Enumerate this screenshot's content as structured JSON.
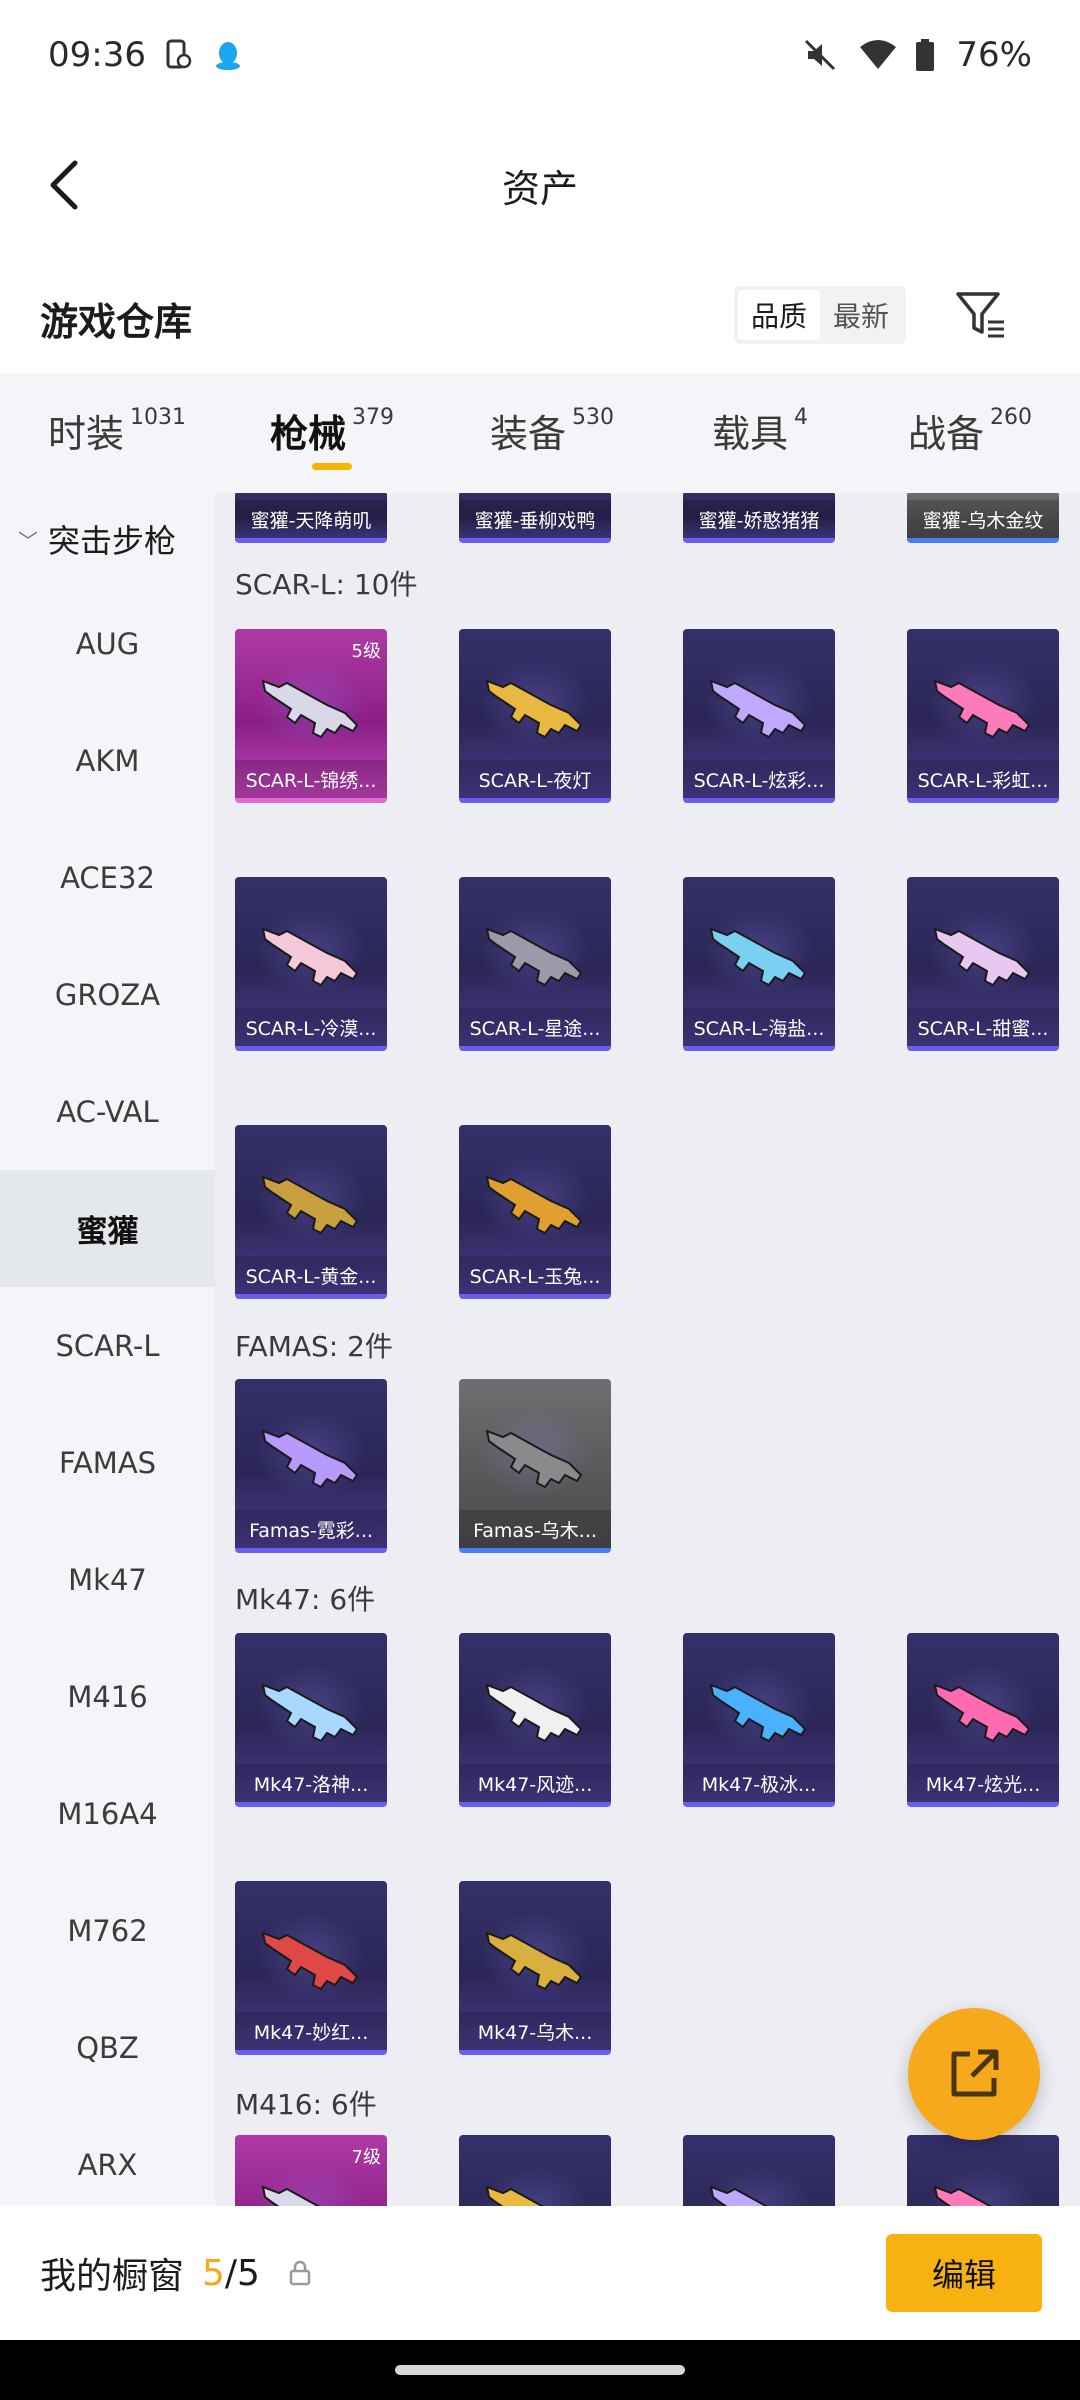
{
  "status_bar": {
    "time": "09:36",
    "battery": "76%",
    "icons": [
      "phone-sync-icon",
      "qq-penguin-icon",
      "mute-icon",
      "wifi-icon",
      "battery-icon"
    ]
  },
  "navbar": {
    "title": "资产",
    "back_icon": "chevron-left-icon"
  },
  "warehouse": {
    "title": "游戏仓库",
    "sort_options": [
      "品质",
      "最新"
    ],
    "sort_selected": "品质",
    "filter_icon": "filter-icon"
  },
  "category_tabs": [
    {
      "label": "时装",
      "count": "1031"
    },
    {
      "label": "枪械",
      "count": "379",
      "active": true
    },
    {
      "label": "装备",
      "count": "530"
    },
    {
      "label": "载具",
      "count": "4"
    },
    {
      "label": "战备",
      "count": "260"
    }
  ],
  "sidebar": {
    "group": "突击步枪",
    "items": [
      "AUG",
      "AKM",
      "ACE32",
      "GROZA",
      "AC-VAL",
      "蜜獾",
      "SCAR-L",
      "FAMAS",
      "Mk47",
      "M416",
      "M16A4",
      "M762",
      "QBZ",
      "ARX"
    ],
    "active": "蜜獾"
  },
  "grid": {
    "top_row": [
      "蜜獾-天降萌叽",
      "蜜獾-垂柳戏鸭",
      "蜜獾-娇憨猪猪",
      "蜜獾-乌木金纹"
    ],
    "sections": [
      {
        "title": "SCAR-L: 10件",
        "items": [
          {
            "name": "SCAR-L-锦绣...",
            "level": "5级"
          },
          {
            "name": "SCAR-L-夜灯"
          },
          {
            "name": "SCAR-L-炫彩..."
          },
          {
            "name": "SCAR-L-彩虹..."
          },
          {
            "name": "SCAR-L-冷漠..."
          },
          {
            "name": "SCAR-L-星途..."
          },
          {
            "name": "SCAR-L-海盐..."
          },
          {
            "name": "SCAR-L-甜蜜..."
          },
          {
            "name": "SCAR-L-黄金..."
          },
          {
            "name": "SCAR-L-玉兔..."
          }
        ]
      },
      {
        "title": "FAMAS: 2件",
        "items": [
          {
            "name": "Famas-霓彩..."
          },
          {
            "name": "Famas-乌木..."
          }
        ]
      },
      {
        "title": "Mk47: 6件",
        "items": [
          {
            "name": "Mk47-洛神..."
          },
          {
            "name": "Mk47-风迹..."
          },
          {
            "name": "Mk47-极冰..."
          },
          {
            "name": "Mk47-炫光..."
          },
          {
            "name": "Mk47-妙红..."
          },
          {
            "name": "Mk47-乌木..."
          }
        ]
      },
      {
        "title": "M416: 6件",
        "items": [
          {
            "name": "",
            "level": "7级"
          },
          {
            "name": ""
          },
          {
            "name": ""
          },
          {
            "name": ""
          }
        ]
      }
    ]
  },
  "fab": {
    "icon": "share-external-icon"
  },
  "showcase": {
    "label": "我的橱窗",
    "current": "5",
    "total": "/5",
    "lock_icon": "lock-icon",
    "edit_label": "编辑"
  },
  "colors": {
    "accent": "#f5b400",
    "edit_button": "#f7b20f",
    "fab": "#f5a91b"
  }
}
